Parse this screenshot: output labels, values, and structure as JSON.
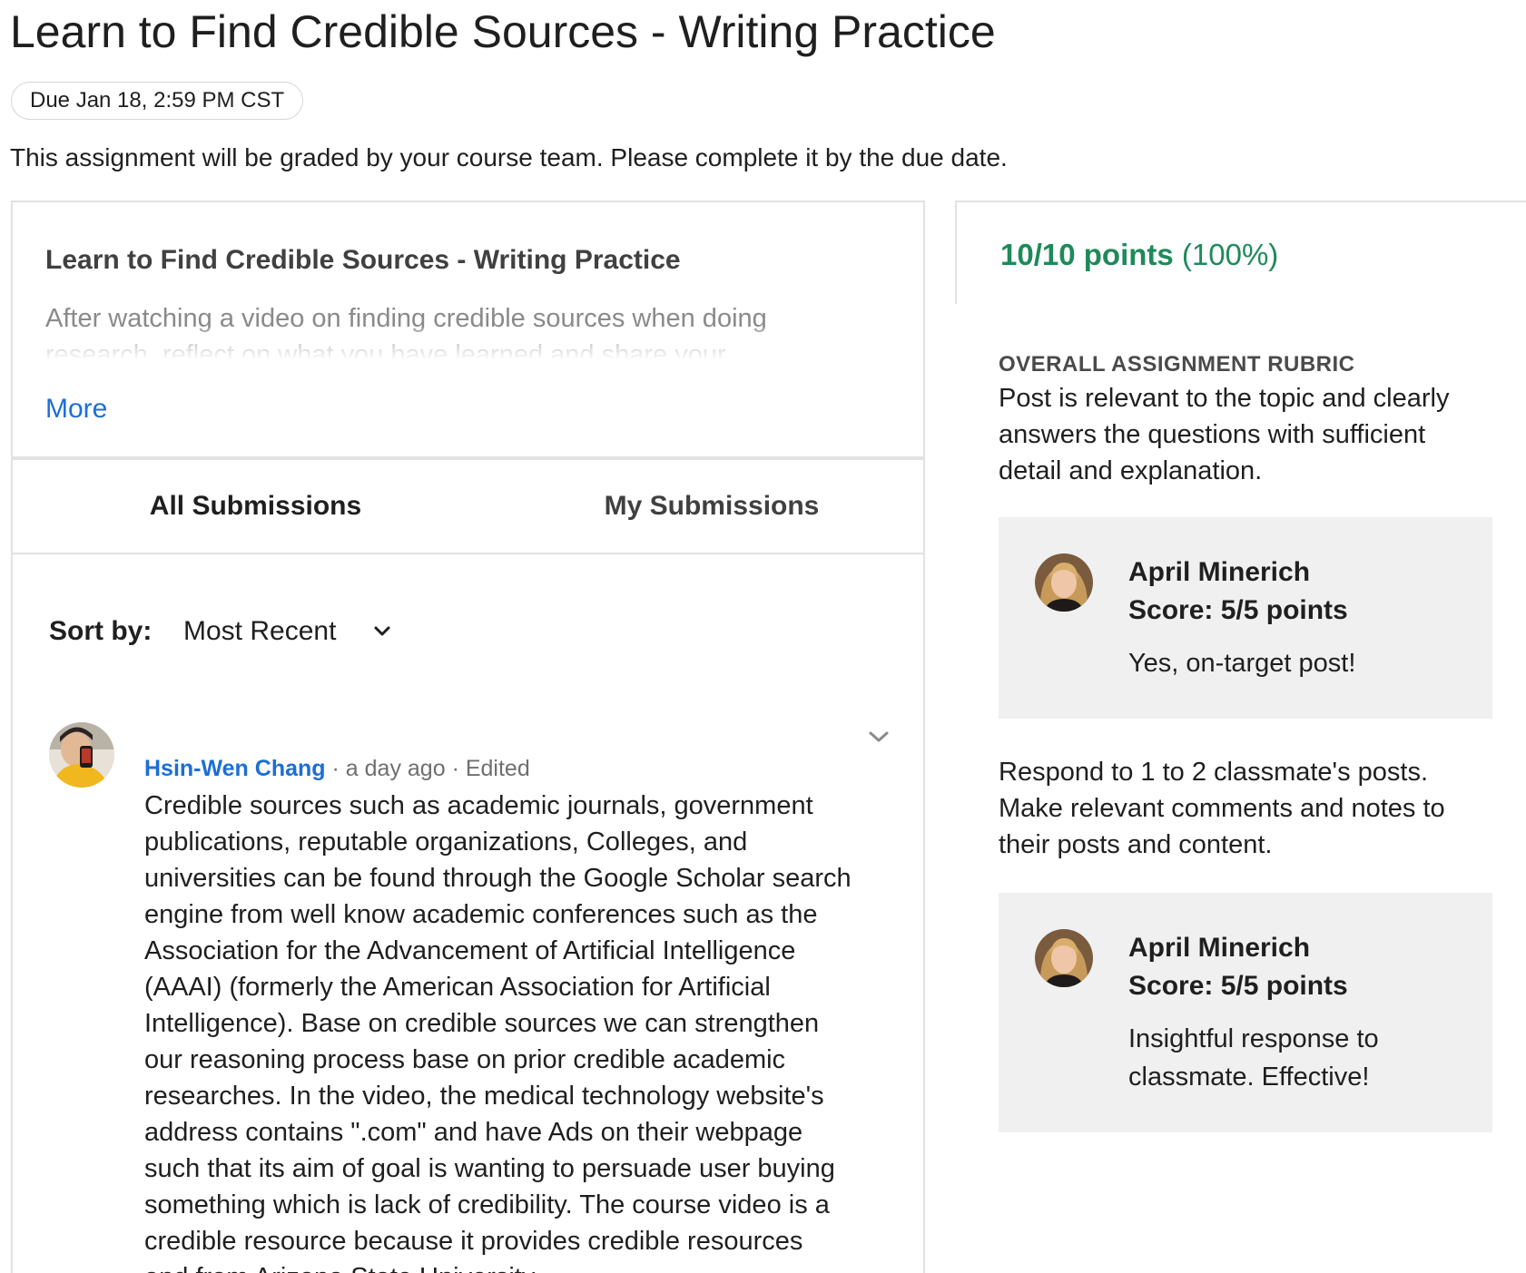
{
  "header": {
    "title": "Learn to Find Credible Sources - Writing Practice",
    "due": "Due Jan 18, 2:59 PM CST",
    "notice": "This assignment will be graded by your course team. Please complete it by the due date."
  },
  "intro": {
    "title": "Learn to Find Credible Sources - Writing Practice",
    "description": "After watching a video on finding credible sources when doing research, reflect on what you have learned and share your",
    "more_label": "More"
  },
  "tabs": [
    {
      "label": "All Submissions",
      "active": true
    },
    {
      "label": "My Submissions",
      "active": false
    }
  ],
  "sort": {
    "label": "Sort by:",
    "value": "Most Recent"
  },
  "submission": {
    "author": "Hsin-Wen Chang",
    "time": "a day ago",
    "status": "Edited",
    "separator": "·",
    "body": "Credible sources such as academic journals, government publications, reputable organizations, Colleges, and universities can be found through the Google Scholar search engine from well know academic conferences such as the Association for the Advancement of Artificial Intelligence (AAAI) (formerly the American Association for Artificial Intelligence). Base on credible sources we can strengthen our reasoning process base on prior credible academic researches. In the video, the medical technology website's address contains \".com\" and have Ads on their webpage such that its aim of goal is wanting to persuade user buying something which is lack of credibility. The course video is a credible resource because it provides credible resources and from Arizona State University."
  },
  "grade": {
    "points": "10/10 points",
    "percent": "(100%)",
    "color": "#1e8a5a"
  },
  "rubric": {
    "heading": "OVERALL ASSIGNMENT RUBRIC",
    "criteria": [
      {
        "text": "Post is relevant to the topic and clearly answers the questions with sufficient detail and explanation.",
        "grader": "April Minerich",
        "score": "Score: 5/5 points",
        "comment": "Yes, on-target post!"
      },
      {
        "text": "Respond to 1 to 2 classmate's posts. Make relevant comments and notes to their posts and content.",
        "grader": "April Minerich",
        "score": "Score: 5/5 points",
        "comment": "Insightful response to classmate. Effective!"
      }
    ]
  },
  "colors": {
    "link": "#1c6ed5",
    "feedback_bg": "#f0f0f0",
    "border": "#e2e2e2"
  }
}
